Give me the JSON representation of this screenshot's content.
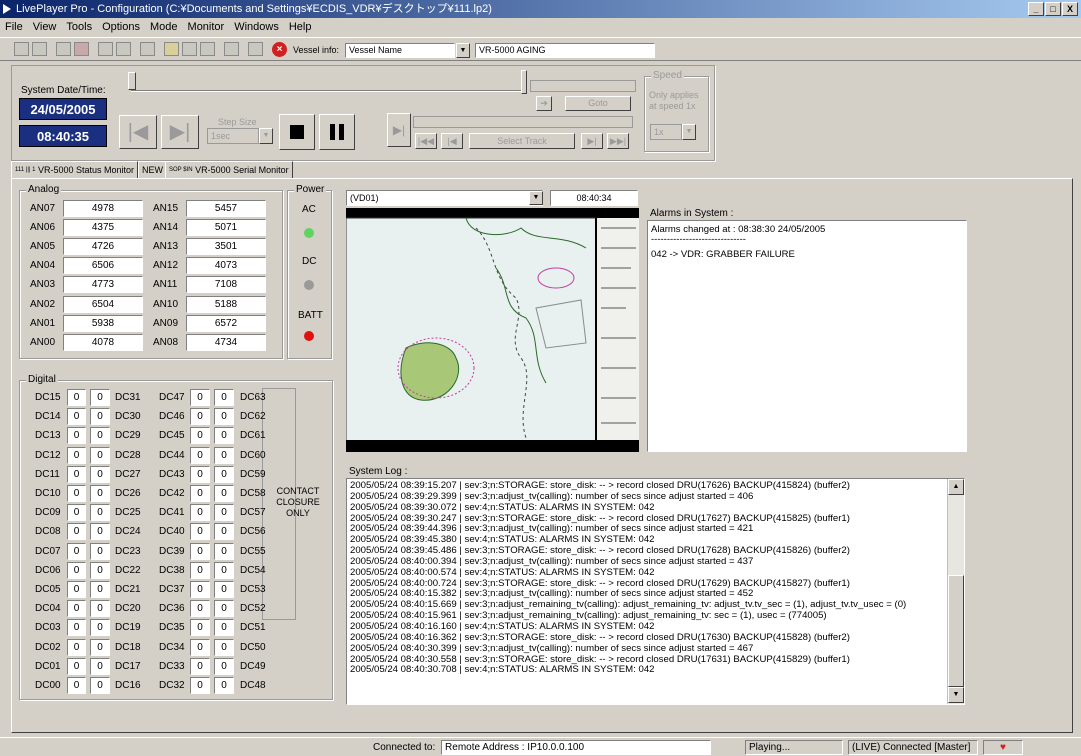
{
  "title": "LivePlayer Pro - Configuration (C:¥Documents and Settings¥ECDIS_VDR¥デスクトップ¥111.lp2)",
  "window_buttons": [
    "_",
    "□",
    "X"
  ],
  "menu": [
    "File",
    "View",
    "Tools",
    "Options",
    "Mode",
    "Monitor",
    "Windows",
    "Help"
  ],
  "toolbar": {
    "vessel_info_label": "Vessel info:",
    "vessel_select": "Vessel Name",
    "vessel_value": "VR-5000 AGING"
  },
  "system": {
    "datetime_label": "System Date/Time:",
    "date": "24/05/2005",
    "time": "08:40:35",
    "step_size_label": "Step Size",
    "step_size_value": "1sec",
    "goto_label": "Goto",
    "select_track_label": "Select Track",
    "speed_label": "Speed",
    "speed_text": "Only applies at speed 1x",
    "speed_value": "1x"
  },
  "tabs": [
    {
      "label": "VR-5000 Status Monitor",
      "tag": "111 ||| 1"
    },
    {
      "label": "NEW",
      "tag": ""
    },
    {
      "label": "VR-5000 Serial Monitor",
      "tag": "SOP $IN"
    }
  ],
  "analog": {
    "label": "Analog",
    "left": [
      {
        "name": "AN07",
        "value": "4978"
      },
      {
        "name": "AN06",
        "value": "4375"
      },
      {
        "name": "AN05",
        "value": "4726"
      },
      {
        "name": "AN04",
        "value": "6506"
      },
      {
        "name": "AN03",
        "value": "4773"
      },
      {
        "name": "AN02",
        "value": "6504"
      },
      {
        "name": "AN01",
        "value": "5938"
      },
      {
        "name": "AN00",
        "value": "4078"
      }
    ],
    "right": [
      {
        "name": "AN15",
        "value": "5457"
      },
      {
        "name": "AN14",
        "value": "5071"
      },
      {
        "name": "AN13",
        "value": "3501"
      },
      {
        "name": "AN12",
        "value": "4073"
      },
      {
        "name": "AN11",
        "value": "7108"
      },
      {
        "name": "AN10",
        "value": "5188"
      },
      {
        "name": "AN09",
        "value": "6572"
      },
      {
        "name": "AN08",
        "value": "4734"
      }
    ]
  },
  "power": {
    "label": "Power",
    "ac": "AC",
    "dc": "DC",
    "batt": "BATT",
    "colors": {
      "ac": "#5fd35f",
      "dc": "#9a9a9a",
      "batt": "#e01010"
    }
  },
  "digital": {
    "label": "Digital",
    "contact_text": "CONTACT CLOSURE ONLY",
    "rows": [
      {
        "l1": "DC15",
        "v1": "0",
        "v2": "0",
        "l2": "DC31",
        "l3": "DC47",
        "v3": "0",
        "v4": "0",
        "l4": "DC63"
      },
      {
        "l1": "DC14",
        "v1": "0",
        "v2": "0",
        "l2": "DC30",
        "l3": "DC46",
        "v3": "0",
        "v4": "0",
        "l4": "DC62"
      },
      {
        "l1": "DC13",
        "v1": "0",
        "v2": "0",
        "l2": "DC29",
        "l3": "DC45",
        "v3": "0",
        "v4": "0",
        "l4": "DC61"
      },
      {
        "l1": "DC12",
        "v1": "0",
        "v2": "0",
        "l2": "DC28",
        "l3": "DC44",
        "v3": "0",
        "v4": "0",
        "l4": "DC60"
      },
      {
        "l1": "DC11",
        "v1": "0",
        "v2": "0",
        "l2": "DC27",
        "l3": "DC43",
        "v3": "0",
        "v4": "0",
        "l4": "DC59"
      },
      {
        "l1": "DC10",
        "v1": "0",
        "v2": "0",
        "l2": "DC26",
        "l3": "DC42",
        "v3": "0",
        "v4": "0",
        "l4": "DC58"
      },
      {
        "l1": "DC09",
        "v1": "0",
        "v2": "0",
        "l2": "DC25",
        "l3": "DC41",
        "v3": "0",
        "v4": "0",
        "l4": "DC57"
      },
      {
        "l1": "DC08",
        "v1": "0",
        "v2": "0",
        "l2": "DC24",
        "l3": "DC40",
        "v3": "0",
        "v4": "0",
        "l4": "DC56"
      },
      {
        "l1": "DC07",
        "v1": "0",
        "v2": "0",
        "l2": "DC23",
        "l3": "DC39",
        "v3": "0",
        "v4": "0",
        "l4": "DC55"
      },
      {
        "l1": "DC06",
        "v1": "0",
        "v2": "0",
        "l2": "DC22",
        "l3": "DC38",
        "v3": "0",
        "v4": "0",
        "l4": "DC54"
      },
      {
        "l1": "DC05",
        "v1": "0",
        "v2": "0",
        "l2": "DC21",
        "l3": "DC37",
        "v3": "0",
        "v4": "0",
        "l4": "DC53"
      },
      {
        "l1": "DC04",
        "v1": "0",
        "v2": "0",
        "l2": "DC20",
        "l3": "DC36",
        "v3": "0",
        "v4": "0",
        "l4": "DC52"
      },
      {
        "l1": "DC03",
        "v1": "0",
        "v2": "0",
        "l2": "DC19",
        "l3": "DC35",
        "v3": "0",
        "v4": "0",
        "l4": "DC51"
      },
      {
        "l1": "DC02",
        "v1": "0",
        "v2": "0",
        "l2": "DC18",
        "l3": "DC34",
        "v3": "0",
        "v4": "0",
        "l4": "DC50"
      },
      {
        "l1": "DC01",
        "v1": "0",
        "v2": "0",
        "l2": "DC17",
        "l3": "DC33",
        "v3": "0",
        "v4": "0",
        "l4": "DC49"
      },
      {
        "l1": "DC00",
        "v1": "0",
        "v2": "0",
        "l2": "DC16",
        "l3": "DC32",
        "v3": "0",
        "v4": "0",
        "l4": "DC48"
      }
    ]
  },
  "video": {
    "source": "(VD01)",
    "time": "08:40:34"
  },
  "alarms": {
    "label": "Alarms in System :",
    "changed": "Alarms changed at : 08:38:30 24/05/2005",
    "separator": "------------------------------",
    "items": [
      "042 -> VDR: GRABBER FAILURE"
    ]
  },
  "log": {
    "label": "System Log :",
    "lines": [
      "2005/05/24 08:39:15.207 | sev:3;n:STORAGE: store_disk: -- > record closed DRU(17626) BACKUP(415824) (buffer2)",
      "2005/05/24 08:39:29.399 | sev:3;n:adjust_tv(calling): number of secs since adjust started = 406",
      "2005/05/24 08:39:30.072 | sev:4;n:STATUS: ALARMS IN SYSTEM: 042",
      "2005/05/24 08:39:30.247 | sev:3;n:STORAGE: store_disk: -- > record closed DRU(17627) BACKUP(415825) (buffer1)",
      "2005/05/24 08:39:44.396 | sev:3;n:adjust_tv(calling): number of secs since adjust started = 421",
      "2005/05/24 08:39:45.380 | sev:4;n:STATUS: ALARMS IN SYSTEM: 042",
      "2005/05/24 08:39:45.486 | sev:3;n:STORAGE: store_disk: -- > record closed DRU(17628) BACKUP(415826) (buffer2)",
      "2005/05/24 08:40:00.394 | sev:3;n:adjust_tv(calling): number of secs since adjust started = 437",
      "2005/05/24 08:40:00.574 | sev:4;n:STATUS: ALARMS IN SYSTEM: 042",
      "2005/05/24 08:40:00.724 | sev:3;n:STORAGE: store_disk: -- > record closed DRU(17629) BACKUP(415827) (buffer1)",
      "2005/05/24 08:40:15.382 | sev:3;n:adjust_tv(calling): number of secs since adjust started = 452",
      "2005/05/24 08:40:15.669 | sev:3;n:adjust_remaining_tv(calling): adjust_remaining_tv: adjust_tv.tv_sec = (1), adjust_tv.tv_usec = (0)",
      "2005/05/24 08:40:15.961 | sev:3;n:adjust_remaining_tv(calling): adjust_remaining_tv: sec = (1), usec = (774005)",
      "2005/05/24 08:40:16.160 | sev:4;n:STATUS: ALARMS IN SYSTEM: 042",
      "2005/05/24 08:40:16.362 | sev:3;n:STORAGE: store_disk: -- > record closed DRU(17630) BACKUP(415828) (buffer2)",
      "2005/05/24 08:40:30.399 | sev:3;n:adjust_tv(calling): number of secs since adjust started = 467",
      "2005/05/24 08:40:30.558 | sev:3;n:STORAGE: store_disk: -- > record closed DRU(17631) BACKUP(415829) (buffer1)",
      "2005/05/24 08:40:30.708 | sev:4;n:STATUS: ALARMS IN SYSTEM: 042"
    ]
  },
  "statusbar": {
    "connected_label": "Connected to:",
    "remote": "Remote Address : IP10.0.0.100",
    "playing": "Playing...",
    "live": "(LIVE) Connected [Master]",
    "heart": "♥"
  }
}
